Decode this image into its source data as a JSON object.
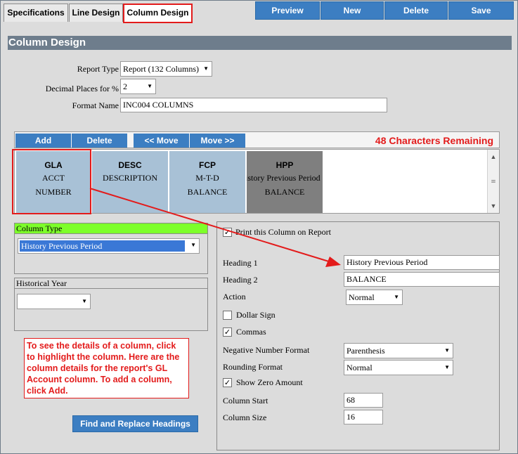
{
  "tabs": [
    {
      "label": "Specifications"
    },
    {
      "label": "Line Design"
    },
    {
      "label": "Column Design"
    }
  ],
  "toolbar": {
    "preview": "Preview",
    "new": "New",
    "delete": "Delete",
    "save": "Save"
  },
  "title": "Column Design",
  "form": {
    "report_type_label": "Report Type",
    "report_type_value": "Report (132 Columns)",
    "decimal_label": "Decimal Places for %",
    "decimal_value": "2",
    "format_name_label": "Format Name",
    "format_name_value": "INC004 COLUMNS"
  },
  "column_toolbar": {
    "add": "Add",
    "delete": "Delete",
    "move_left": "<< Move",
    "move_right": "Move >>",
    "remaining": "48 Characters Remaining"
  },
  "columns": [
    {
      "code": "GLA",
      "line1": "ACCT",
      "line2": "NUMBER"
    },
    {
      "code": "DESC",
      "line1": "DESCRIPTION",
      "line2": ""
    },
    {
      "code": "FCP",
      "line1": "M-T-D",
      "line2": "BALANCE"
    },
    {
      "code": "HPP",
      "line1": "History Previous Period",
      "line2": "BALANCE"
    }
  ],
  "column_type": {
    "label": "Column Type",
    "value": "History Previous Period"
  },
  "historical_year": {
    "label": "Historical Year",
    "value": ""
  },
  "callout": "To see the details of a column, click to highlight the column. Here are the column details for the report's GL Account column. To add a column, click Add.",
  "find_replace": "Find and Replace Headings",
  "details": {
    "print_label": "Print this Column on Report",
    "print_checked": true,
    "heading1_label": "Heading 1",
    "heading1_value": "History Previous Period",
    "heading2_label": "Heading 2",
    "heading2_value": "BALANCE",
    "action_label": "Action",
    "action_value": "Normal",
    "dollar_label": "Dollar Sign",
    "dollar_checked": false,
    "commas_label": "Commas",
    "commas_checked": true,
    "negative_label": "Negative Number Format",
    "negative_value": "Parenthesis",
    "rounding_label": "Rounding Format",
    "rounding_value": "Normal",
    "zero_label": "Show Zero Amount",
    "zero_checked": true,
    "col_start_label": "Column Start",
    "col_start_value": "68",
    "col_size_label": "Column Size",
    "col_size_value": "16"
  },
  "colors": {
    "accent": "#3c7ec2",
    "highlight": "#e31b1b",
    "column_bg": "#a8c1d6",
    "green_header": "#7dff2a"
  }
}
